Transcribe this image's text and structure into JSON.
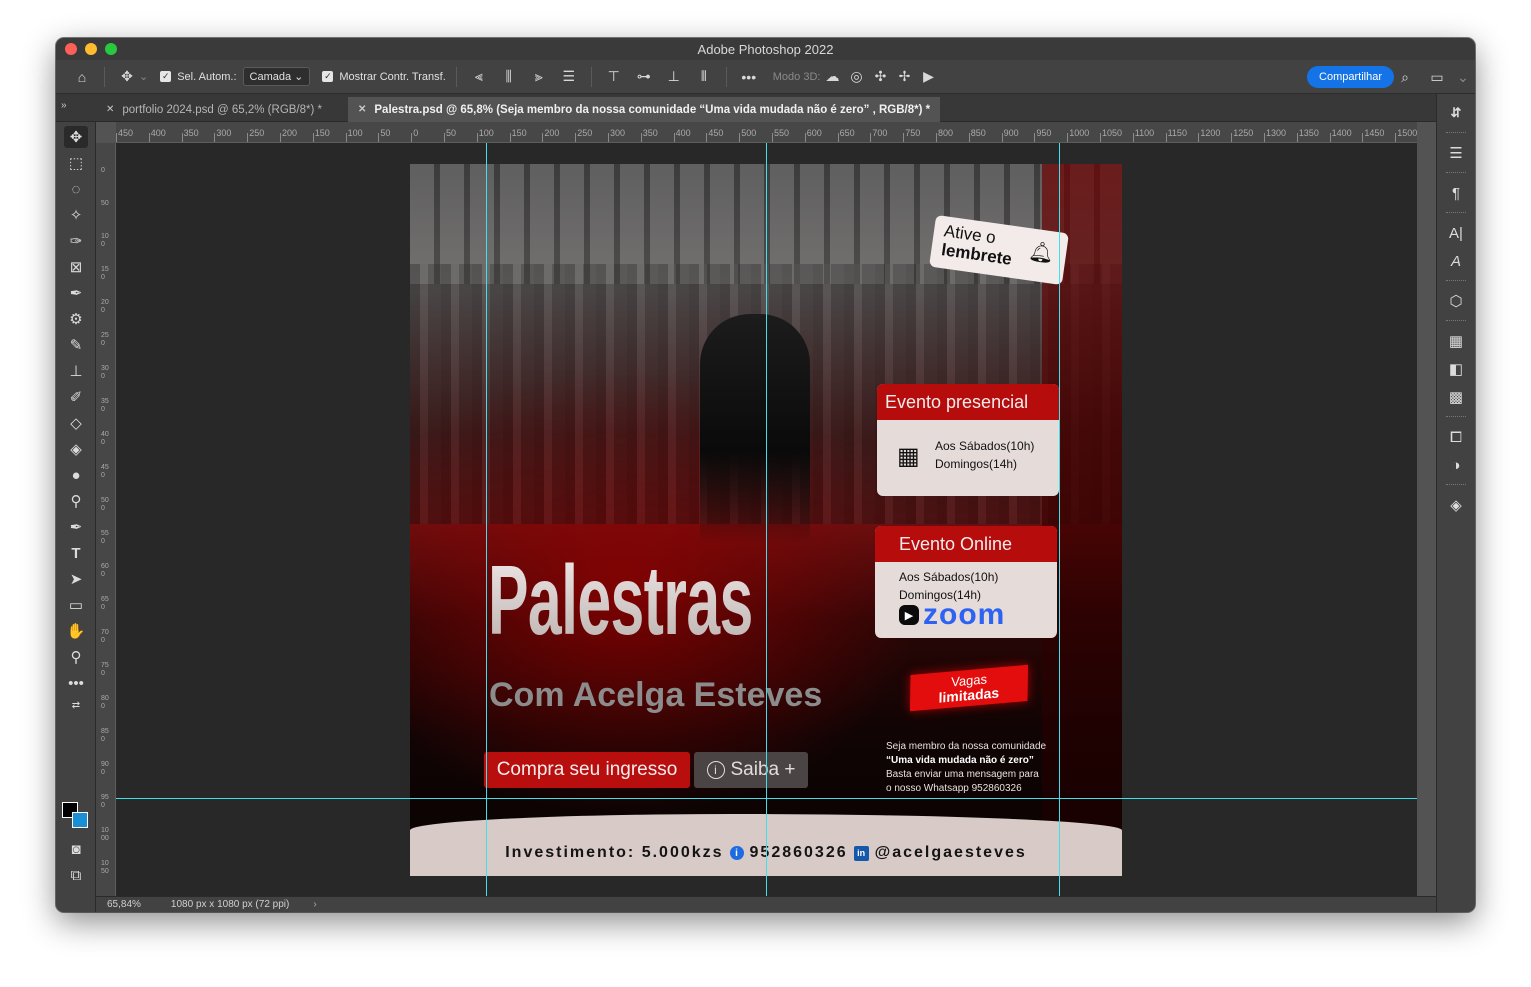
{
  "window": {
    "title": "Adobe Photoshop 2022"
  },
  "options": {
    "auto_select_label": "Sel. Autom.:",
    "auto_select_value": "Camada",
    "show_transform_label": "Mostrar Contr. Transf.",
    "mode3d_label": "Modo 3D:",
    "share_label": "Compartilhar"
  },
  "tabs": [
    {
      "label": "portfolio 2024.psd @ 65,2% (RGB/8*) *"
    },
    {
      "label": "Palestra.psd @ 65,8% (Seja membro da nossa comunidade “Uma vida mudada não é zero” , RGB/8*) *"
    }
  ],
  "ruler": {
    "top_ticks": [
      "450",
      "400",
      "350",
      "300",
      "250",
      "200",
      "150",
      "100",
      "50",
      "0",
      "50",
      "100",
      "150",
      "200",
      "250",
      "300",
      "350",
      "400",
      "450",
      "500",
      "550",
      "600",
      "650",
      "700",
      "750",
      "800",
      "850",
      "900",
      "950",
      "1000",
      "1050",
      "1100",
      "1150",
      "1200",
      "1250",
      "1300",
      "1350",
      "1400",
      "1450",
      "1500"
    ],
    "left_ticks": [
      "0",
      "50",
      "100",
      "150",
      "200",
      "250",
      "300",
      "350",
      "400",
      "450",
      "500",
      "550",
      "600",
      "650",
      "700",
      "750",
      "800",
      "850",
      "900",
      "950",
      "1000",
      "1050"
    ]
  },
  "poster": {
    "title": "Palestras",
    "subtitle": "Com Acelga Esteves",
    "buy_button": "Compra seu ingresso",
    "more_button": "Saiba +",
    "reminder_line1": "Ative o",
    "reminder_line2": "lembrete",
    "presencial": {
      "header": "Evento presencial",
      "line1": "Aos Sábados(10h)",
      "line2": "Domingos(14h)"
    },
    "online": {
      "header": "Evento Online",
      "line1": "Aos Sábados(10h)",
      "line2": "Domingos(14h)",
      "logo": "zoom"
    },
    "vagas_line1": "Vagas",
    "vagas_line2": "limitadas",
    "member_line1": "Seja membro da nossa comunidade",
    "member_line2": "“Uma vida mudada não é zero”",
    "member_line3": "Basta enviar uma mensagem para",
    "member_line4": "o nosso Whatsapp 952860326",
    "footer_invest": "Investimento: 5.000kzs",
    "footer_phone": "952860326",
    "footer_handle": "@acelgaesteves"
  },
  "status": {
    "zoom": "65,84%",
    "doc_info": "1080 px x 1080 px (72 ppi)"
  },
  "colors": {
    "accent": "#1473e6",
    "guide": "#3fe0ea",
    "poster_red": "#b70c0c"
  }
}
